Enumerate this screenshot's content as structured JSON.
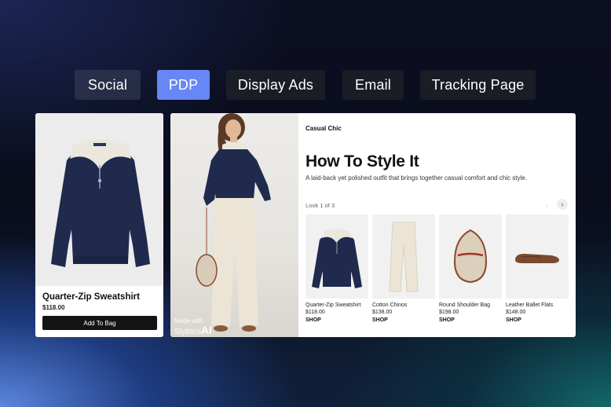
{
  "tabs": [
    {
      "label": "Social"
    },
    {
      "label": "PDP"
    },
    {
      "label": "Display Ads"
    },
    {
      "label": "Email"
    },
    {
      "label": "Tracking Page"
    }
  ],
  "product_card": {
    "name": "Quarter-Zip Sweatshirt",
    "price": "$118.00",
    "button_label": "Add To Bag"
  },
  "outfit": {
    "eyebrow": "Casual Chic",
    "title": "How To Style It",
    "description": "A laid-back yet polished outfit that brings together casual comfort and chic style.",
    "look_counter": "Look 1 of 3",
    "watermark_line1": "Made with",
    "watermark_brand": "Stylitics",
    "watermark_suffix": "AI",
    "items": [
      {
        "name": "Quarter-Zip Sweatshirt",
        "price": "$118.00",
        "shop": "SHOP"
      },
      {
        "name": "Cotton Chinos",
        "price": "$138.00",
        "shop": "SHOP"
      },
      {
        "name": "Round Shoulder Bag",
        "price": "$198.00",
        "shop": "SHOP"
      },
      {
        "name": "Leather Ballet Flats",
        "price": "$148.00",
        "shop": "SHOP"
      }
    ]
  },
  "colors": {
    "active_tab": "#6687f5",
    "navy": "#1f2a4d",
    "cream": "#ece7dd"
  }
}
